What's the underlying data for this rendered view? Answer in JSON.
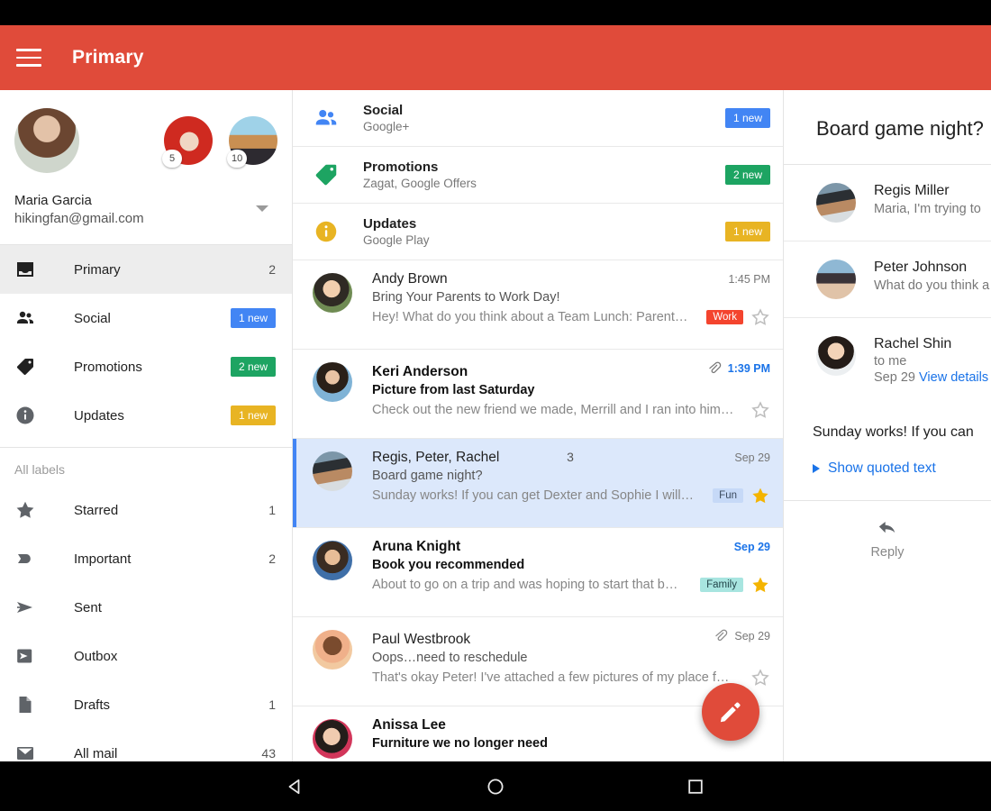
{
  "actionbar": {
    "title": "Primary",
    "menu_icon": "hamburger-menu-icon"
  },
  "account": {
    "name": "Maria Garcia",
    "email": "hikingfan@gmail.com",
    "secondary_accounts": [
      {
        "badge": "5"
      },
      {
        "badge": "10"
      }
    ]
  },
  "sidebar": {
    "inboxes": [
      {
        "label": "Primary",
        "count": "2",
        "badge": "",
        "icon": "inbox-icon",
        "active": true
      },
      {
        "label": "Social",
        "count": "",
        "badge": "1 new",
        "badge_color": "#4285f4",
        "icon": "people-icon",
        "active": false
      },
      {
        "label": "Promotions",
        "count": "",
        "badge": "2 new",
        "badge_color": "#1da462",
        "icon": "tag-icon",
        "active": false
      },
      {
        "label": "Updates",
        "count": "",
        "badge": "1 new",
        "badge_color": "#e8b423",
        "icon": "info-icon",
        "active": false
      }
    ],
    "all_labels_heading": "All labels",
    "labels": [
      {
        "label": "Starred",
        "count": "1",
        "icon": "star-icon"
      },
      {
        "label": "Important",
        "count": "2",
        "icon": "important-icon"
      },
      {
        "label": "Sent",
        "count": "",
        "icon": "send-icon"
      },
      {
        "label": "Outbox",
        "count": "",
        "icon": "outbox-icon"
      },
      {
        "label": "Drafts",
        "count": "1",
        "icon": "draft-icon"
      },
      {
        "label": "All mail",
        "count": "43",
        "icon": "mail-icon"
      }
    ]
  },
  "list": {
    "categories": [
      {
        "title": "Social",
        "subtitle": "Google+",
        "badge": "1 new",
        "badge_color": "#4285f4",
        "icon": "people-icon",
        "icon_color": "#4285f4"
      },
      {
        "title": "Promotions",
        "subtitle": "Zagat, Google Offers",
        "badge": "2 new",
        "badge_color": "#1da462",
        "icon": "tag-icon",
        "icon_color": "#1da462"
      },
      {
        "title": "Updates",
        "subtitle": "Google Play",
        "badge": "1 new",
        "badge_color": "#e8b423",
        "icon": "info-icon",
        "icon_color": "#e8b423"
      }
    ],
    "emails": [
      {
        "sender": "Andy Brown",
        "thread_count": "",
        "subject": "Bring Your Parents to Work Day!",
        "snippet": "Hey! What do you think about a Team Lunch: Parent…",
        "time": "1:45 PM",
        "unread": false,
        "attachment": false,
        "chip": "Work",
        "chip_bg": "#f4442e",
        "chip_color": "#ffffff",
        "starred": false
      },
      {
        "sender": "Keri Anderson",
        "thread_count": "",
        "subject": "Picture from last Saturday",
        "snippet": "Check out the new friend we made, Merrill and I ran into him…",
        "time": "1:39 PM",
        "unread": true,
        "attachment": true,
        "chip": "",
        "starred": false
      },
      {
        "sender": "Regis, Peter, Rachel",
        "thread_count": "3",
        "subject": "Board game night?",
        "snippet": "Sunday works! If you can get Dexter and Sophie I will…",
        "time": "Sep 29",
        "unread": false,
        "attachment": false,
        "chip": "Fun",
        "chip_bg": "#c6d9f7",
        "chip_color": "#3b4a5e",
        "starred": true,
        "selected": true
      },
      {
        "sender": "Aruna Knight",
        "thread_count": "",
        "subject": "Book you recommended",
        "snippet": "About to go on a trip and was hoping to start that b…",
        "time": "Sep 29",
        "unread": true,
        "attachment": false,
        "chip": "Family",
        "chip_bg": "#a8e5e0",
        "chip_color": "#23454a",
        "starred": true
      },
      {
        "sender": "Paul Westbrook",
        "thread_count": "",
        "subject": "Oops…need to reschedule",
        "snippet": "That's okay Peter! I've attached a few pictures of my place f…",
        "time": "Sep 29",
        "unread": false,
        "attachment": true,
        "chip": "",
        "starred": false
      },
      {
        "sender": "Anissa Lee",
        "thread_count": "",
        "subject": "Furniture we no longer need",
        "snippet": "",
        "time": "",
        "unread": true,
        "attachment": false,
        "chip": "",
        "starred": false
      }
    ],
    "compose_icon": "pencil-compose-icon"
  },
  "detail": {
    "subject": "Board game night?",
    "messages": [
      {
        "name": "Regis Miller",
        "preview": "Maria, I'm trying to"
      },
      {
        "name": "Peter Johnson",
        "preview": "What do you think a"
      }
    ],
    "open_message": {
      "name": "Rachel Shin",
      "recipient": "to me",
      "date": "Sep 29",
      "details_link": "View details",
      "body": "Sunday works! If you can",
      "quoted_label": "Show quoted text"
    },
    "reply_label": "Reply",
    "reply_icon": "reply-arrow-icon"
  },
  "navbar": {
    "back": "back-triangle-icon",
    "home": "home-circle-icon",
    "recents": "recents-square-icon"
  },
  "colors": {
    "header_red": "#e04b3a",
    "accent_blue": "#4285f4",
    "selected_row": "#dce8fb"
  }
}
